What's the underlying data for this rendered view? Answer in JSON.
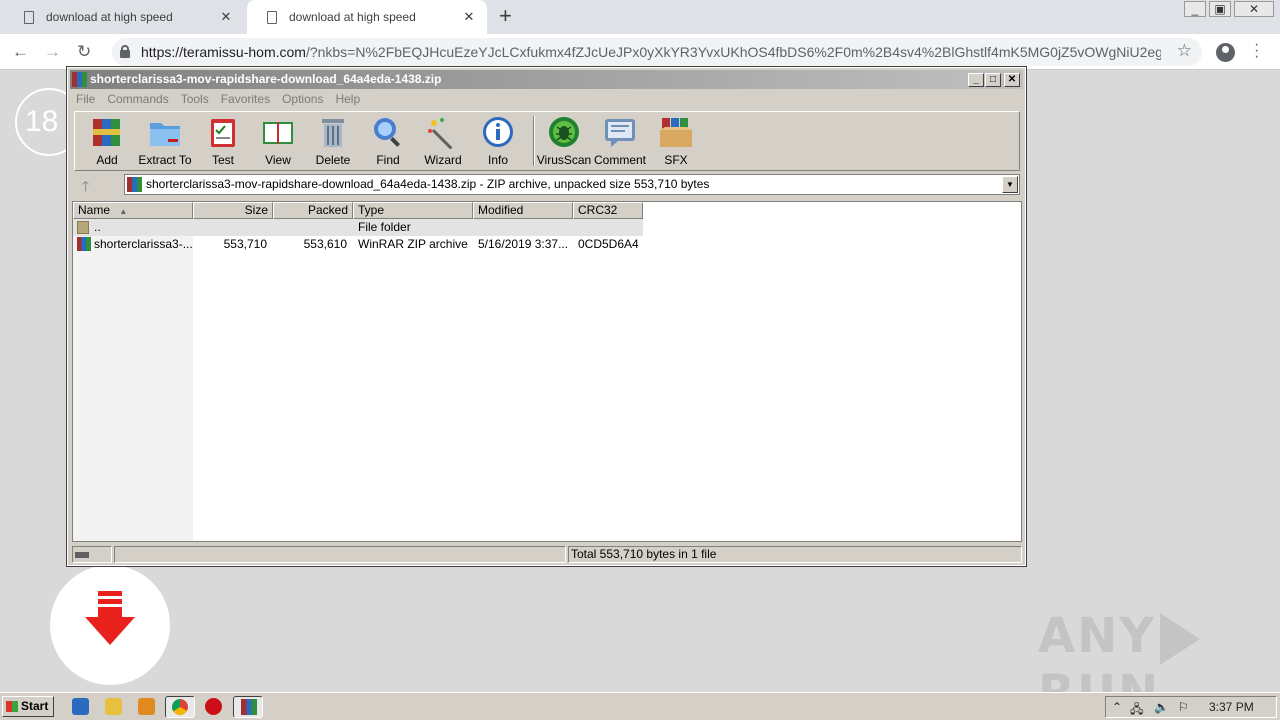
{
  "browser": {
    "tabs": [
      {
        "title": "download at high speed",
        "close": "✕"
      },
      {
        "title": "download at high speed",
        "close": "✕"
      }
    ],
    "new_tab": "+",
    "url_host": "https://teramissu-hom.com",
    "url_rest": "/?nkbs=N%2FbEQJHcuEzeYJcLCxfukmx4fZJcUeJPx0yXkYR3YvxUKhOS4fbDS6%2F0m%2B4sv4%2BlGhstlf4mK5MG0jZ5vOWgNiU2egG...",
    "nav": {
      "back": "←",
      "forward": "→",
      "reload": "↻",
      "star": "☆"
    }
  },
  "page": {
    "age_badge": "18",
    "watermark_left": "ANY",
    "watermark_right": "RUN"
  },
  "winrar": {
    "title": "shorterclarissa3-mov-rapidshare-download_64a4eda-1438.zip",
    "window_buttons": {
      "min": "_",
      "max": "□",
      "close": "✕"
    },
    "menu": [
      "File",
      "Commands",
      "Tools",
      "Favorites",
      "Options",
      "Help"
    ],
    "tools": [
      {
        "label": "Add",
        "icon": "add-archive-icon"
      },
      {
        "label": "Extract To",
        "icon": "extract-folder-icon"
      },
      {
        "label": "Test",
        "icon": "test-clipboard-icon"
      },
      {
        "label": "View",
        "icon": "view-book-icon"
      },
      {
        "label": "Delete",
        "icon": "trash-can-icon"
      },
      {
        "label": "Find",
        "icon": "magnifier-icon"
      },
      {
        "label": "Wizard",
        "icon": "magic-wand-icon"
      },
      {
        "label": "Info",
        "icon": "info-icon"
      },
      {
        "label": "VirusScan",
        "icon": "virus-bug-icon"
      },
      {
        "label": "Comment",
        "icon": "comment-icon"
      },
      {
        "label": "SFX",
        "icon": "sfx-box-icon"
      }
    ],
    "path_text": "shorterclarissa3-mov-rapidshare-download_64a4eda-1438.zip - ZIP archive, unpacked size 553,710 bytes",
    "columns": [
      "Name",
      "Size",
      "Packed",
      "Type",
      "Modified",
      "CRC32"
    ],
    "rows": [
      {
        "name": "..",
        "size": "",
        "packed": "",
        "type": "File folder",
        "modified": "",
        "crc": ""
      },
      {
        "name": "shorterclarissa3-...",
        "size": "553,710",
        "packed": "553,610",
        "type": "WinRAR ZIP archive",
        "modified": "5/16/2019 3:37...",
        "crc": "0CD5D6A4"
      }
    ],
    "status_total": "Total 553,710 bytes in 1 file"
  },
  "taskbar": {
    "start_label": "Start",
    "clock": "3:37 PM",
    "tray_arrow": "⌃"
  },
  "colors": {
    "accent_red": "#e8211c",
    "chrome_bg": "#dee1e6",
    "win_face": "#d4d0c8"
  }
}
